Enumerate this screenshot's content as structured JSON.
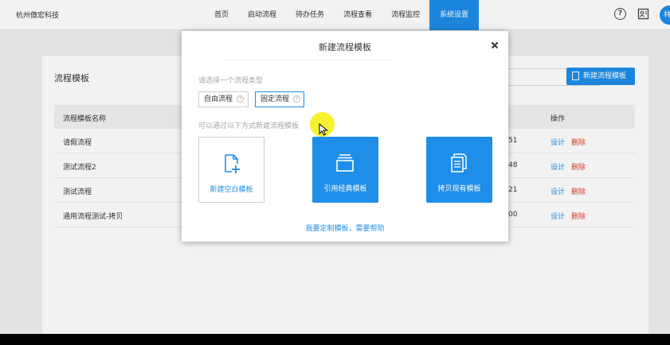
{
  "header": {
    "brand": "杭州傲宏科技",
    "nav": [
      "首页",
      "启动流程",
      "待办任务",
      "流程查看",
      "流程监控",
      "系统设置"
    ],
    "active_nav": "系统设置",
    "avatar_text": "林",
    "icons": [
      "help-icon",
      "contact-card-icon"
    ]
  },
  "page": {
    "title": "流程模板",
    "new_button_label": "新建流程模板",
    "table": {
      "columns": [
        "流程模板名称",
        "操作"
      ],
      "rows": [
        {
          "name": "请假流程",
          "time_tail": "51",
          "design": "设计",
          "delete": "删除"
        },
        {
          "name": "测试流程2",
          "time_tail": "48",
          "design": "设计",
          "delete": "删除"
        },
        {
          "name": "测试流程",
          "time_tail": "21",
          "design": "设计",
          "delete": "删除"
        },
        {
          "name": "通用流程测试-拷贝",
          "time_tail": "00",
          "design": "设计",
          "delete": "删除"
        }
      ]
    }
  },
  "modal": {
    "title": "新建流程模板",
    "prompt": "请选择一个流程类型",
    "types": [
      {
        "label": "自由流程",
        "selected": false
      },
      {
        "label": "固定流程",
        "selected": true
      }
    ],
    "hint": "可以通过以下方式新建流程模板",
    "cards": [
      {
        "label": "新建空白模板",
        "icon": "new-file-icon"
      },
      {
        "label": "引用经典模板",
        "icon": "template-stack-icon"
      },
      {
        "label": "拷贝现有模板",
        "icon": "copy-document-icon"
      }
    ],
    "help_link": "我要定制模板，需要帮助"
  },
  "colors": {
    "primary": "#1e8ee8",
    "danger": "#e0412e",
    "cursor_highlight": "#f6ee0a"
  }
}
